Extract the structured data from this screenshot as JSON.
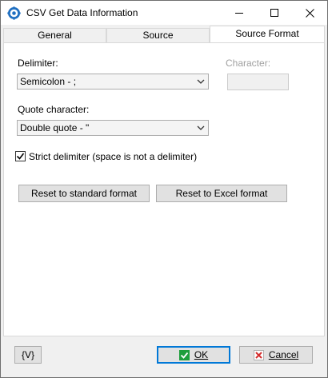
{
  "window": {
    "title": "CSV Get Data Information",
    "app_icon": "gear-cog-icon"
  },
  "tabs": [
    {
      "label": "General",
      "active": false
    },
    {
      "label": "Source",
      "active": false
    },
    {
      "label": "Source Format",
      "active": true
    }
  ],
  "form": {
    "delimiter_label": "Delimiter:",
    "delimiter_value": "Semicolon - ;",
    "character_label": "Character:",
    "character_value": "",
    "quote_label": "Quote character:",
    "quote_value": "Double quote - \"",
    "strict_label": "Strict delimiter (space is not a delimiter)",
    "strict_checked": true,
    "reset_standard_label": "Reset to standard format",
    "reset_excel_label": "Reset to Excel format"
  },
  "footer": {
    "variables_label": "{V}",
    "ok_label": "OK",
    "cancel_label": "Cancel"
  },
  "colors": {
    "accent": "#0078d7",
    "ok_icon": "#1e9e3b",
    "cancel_icon": "#d32f2f"
  }
}
